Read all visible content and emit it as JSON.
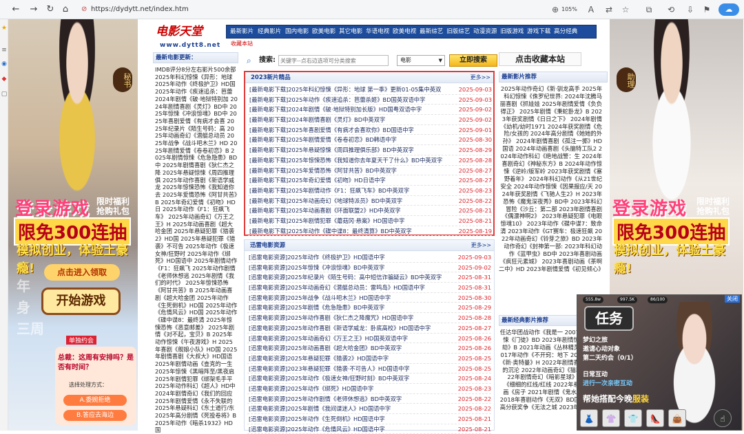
{
  "browser": {
    "url": "https://dydytt.net/index.htm",
    "zoom": "105%"
  },
  "left_ad": {
    "tag": "秘书",
    "line1": "登录游戏",
    "line1b": "限时福利抢购礼包",
    "line2": "限免300连抽",
    "line3": "模拟创业，体验土豪瘾!",
    "enter": "点击进入领取",
    "start": "开始游戏",
    "bg1": "年",
    "bg2": "身",
    "bg3": "三周",
    "chat_top": "单独约会",
    "chat_q": "总裁：这周有安排吗？是否有时间？",
    "choose": "选择处理方式：",
    "opt_a": "A.委婉拒绝",
    "opt_b": "B.答应去海边"
  },
  "right_ad": {
    "tag": "助理",
    "line1": "登录游戏",
    "line1b": "限时福利抢购礼包",
    "line2": "限免300连抽",
    "line3": "模拟创业，体验土豪瘾!"
  },
  "site": {
    "logo": "电影天堂",
    "logo_sub": "www.dytt8.net",
    "nav": [
      "最新影片",
      "经典影片",
      "国内电影",
      "欧美电影",
      "其它电影",
      "华语电视",
      "欧美电视",
      "最新综艺",
      "旧版综艺",
      "动漫资源",
      "旧版游戏",
      "游戏下载",
      "高分经典"
    ],
    "subnav": "收藏本站",
    "left_head": "最新电影更新：",
    "left_text": "IMDB评分8分左右影片500余部 2025年科幻惊悚《异形：地球 2025年动作《终极护卫》HD国 2025年动作《疾速追杀：芭蕾 2024年剧情《破·地狱特别加 2024年剧情喜剧《灵灯》BD中 2025年惊悚《冲浪惊魂》BD中 2025年喜剧爱情《有病才会喜 2025年纪录片《陌生号码：高 2025年动画奇幻《潜艇总动员 2025年战争《战斗吧木兰》HD 2025年剧情爱情《卷卷初恋》B 2025年剧情惊悚《危急隐患》BD中 2025年剧情喜剧《狄仁杰之降 2025年悬疑惊悚《周四推理俱 2025年动作喜剧《新语学威龙 2025年惊悚恐怖《我知道你去 2025年爱情恐怖《阿甘共苦》B 2025年奇幻爱情《初吻》HD日 2025年动作《F1：狂飙飞车》 2025年动画奇幻《万王之王》H 2025年动画喜剧《超大哈金团 2025年悬疑犯罪《猎袭2》HD国 2025年悬疑犯罪《猎袭》不可告 2025年动作《极速女神/狂野时 2025年动作《绑死》HD国语中 2025年剧情动作《F1：狂飙飞 2025年动作剧情《老师休想逃 2025年剧情《我们的时代》 2025年惊悚恐怖《阿甘共苦》B 2025年动画喜剧《超大哈金团 2025年动作《生死倒机》HD国 2025年动作《危情风云》HD国 2025年动作《碟中谍8：最终清 2025年惊悚恐怖《恶意邮差》 2025年剧情《对不起，宝贝》B 2025年动作惊悚《午夜游戏》H 2025年喜剧《舰娘小队》HD国 2025年剧情喜剧《大叔大》HD国语 2025年剧情动画《查克的一生 2025年惊悚《黑暗阵至/黑夜启 2025年剧情犯罪《绑架毛手平 2025年动作科幻《超人》HD中 2024年剧情奇幻《我们的回应 2025年剧情爱情《永不失联的 2025年悬疑科幻《东土道行/东 2025年高分剧情《死投卷将》B 2025年动作《暗杀1932》HD国"
  },
  "search": {
    "label": "搜索:",
    "placeholder": "关键字--点右边选项可分类搜索",
    "select": "电影",
    "button": "立即搜索"
  },
  "box_new": {
    "title": "2023新片精品",
    "more": "更多>>",
    "rows": [
      {
        "title": "[最新电影下载]2025年科幻惊悚《异形：地球 第一季》更新01-05集中英双",
        "date": "2025-09-03"
      },
      {
        "title": "[最新电影下载]2025年动作《疾速追杀：芭蕾杀姬》BD国英双语中字",
        "date": "2025-09-03"
      },
      {
        "title": "[最新电影下载]2024年剧情《破·地狱特别加长版》HD国粤双语中字",
        "date": "2025-09-02"
      },
      {
        "title": "[最新电影下载]2024年剧情喜剧《灵灯》BD中英双字",
        "date": "2025-09-02"
      },
      {
        "title": "[最新电影下载]2025年喜剧爱情《有病才会喜欢你》BD国语中字",
        "date": "2025-09-01"
      },
      {
        "title": "[最新电影下载]2025年剧情爱情《卷卷初恋》BD韩语中字",
        "date": "2025-08-30"
      },
      {
        "title": "[最新电影下载]2025年悬疑惊悚《周四推理俱乐部》BD中英双字",
        "date": "2025-08-29"
      },
      {
        "title": "[最新电影下载]2025年惊悚恐怖《我知道你去年夏天干了什么》BD中英双字",
        "date": "2025-08-28"
      },
      {
        "title": "[最新电影下载]2025年爱情恐怖《阿甘共苦》BD中英双字",
        "date": "2025-08-27"
      },
      {
        "title": "[最新电影下载]2025年奇幻爱情《初吻》HD日语中字",
        "date": "2025-08-27"
      },
      {
        "title": "[最新电影下载]2025年剧情动作《F1：狂飙飞车》BD中英双字",
        "date": "2025-08-23"
      },
      {
        "title": "[最新电影下载]2025年动画奇幻《地球特派员》BD中英双字",
        "date": "2025-08-22"
      },
      {
        "title": "[最新电影下载]2025年动画喜剧《环面联盟2》HD中英双字",
        "date": "2025-08-21"
      },
      {
        "title": "[最新电影下载]2025年剧情犯罪《蘑菇冈·悬案》HD国语中字",
        "date": "2025-08-21"
      },
      {
        "title": "[最新电影下载]2025年动作《碟中谍8：最终清算》BD中英双字",
        "date": "2025-08-19"
      }
    ]
  },
  "box_xl": {
    "title": "迅雷电影资源",
    "more": "更多>>",
    "rows": [
      {
        "title": "[迅雷电影资源]2025年动作《终极护卫》HD国语中字",
        "date": "2025-09-03"
      },
      {
        "title": "[迅雷电影资源]2025年惊悚《冲浪惊魂》BD中英双字",
        "date": "2025-09-02"
      },
      {
        "title": "[迅雷电影资源]2025年纪录片《陌生号码：高中短信诈骗疑云》BD中英双字",
        "date": "2025-08-31"
      },
      {
        "title": "[迅雷电影资源]2025年动画奇幻《潜艇总动员：雷鸣岛》HD国语中字",
        "date": "2025-08-31"
      },
      {
        "title": "[迅雷电影资源]2025年战争《战斗吧木兰》HD国语中字",
        "date": "2025-08-30"
      },
      {
        "title": "[迅雷电影资源]2025年剧情《危急隐患》BD中英双字",
        "date": "2025-08-29"
      },
      {
        "title": "[迅雷电影资源]2025年动作喜剧《狄仁杰之降魔咒》HD国语中字",
        "date": "2025-08-28"
      },
      {
        "title": "[迅雷电影资源]2025年动作喜剧《新语学威龙：卧底高校》HD国语中字",
        "date": "2025-08-27"
      },
      {
        "title": "[迅雷电影资源]2025年动画奇幻《万王之王》HD国英双语中字",
        "date": "2025-08-26"
      },
      {
        "title": "[迅雷电影资源]2025年动画喜剧《超大哈金团》BD中英双字",
        "date": "2025-08-26"
      },
      {
        "title": "[迅雷电影资源]2025年悬疑犯罪《猎袭2》HD国语中字",
        "date": "2025-08-25"
      },
      {
        "title": "[迅雷电影资源]2023年悬疑犯罪《猎袭·不可告人》HD国语中字",
        "date": "2025-08-25"
      },
      {
        "title": "[迅雷电影资源]2025年动作《极速女神/狂野时刻》BD中英双字",
        "date": "2025-08-24"
      },
      {
        "title": "[迅雷电影资源]2025年动作《绑死》HD国语中字",
        "date": "2025-08-23"
      },
      {
        "title": "[迅雷电影资源]2025年动作剧情《老师休想逃》BD中英双字",
        "date": "2025-08-22"
      },
      {
        "title": "[迅雷电影资源]2025年剧情《我间谍迷人》HD国语中字",
        "date": "2025-08-22"
      },
      {
        "title": "[迅雷电影资源]2025年动作《生死倒机》HD国语中字",
        "date": "2025-08-21"
      },
      {
        "title": "[迅雷电影资源]2025年动作《危情风云》HD国语中字",
        "date": "2025-08-21"
      }
    ]
  },
  "right_col": {
    "collect": "点击收藏本站",
    "head1": "最新影片推荐",
    "list1": "2025年动作奇幻《新·驯龙高手 2025年科幻惊悚《侏罗纪世界: 2024年沈腾马丽喜剧《抓娃娃 2025年剧情爱情《负负得正》 2025年剧情《秉蛇卧龙》B 2023年获奖剧情《日日之下》 2024年剧情《幼机/幼时1971 2024年获奖剧情《危险/女孩的 2024年高分剧情《她她的外孙》 2024年剧情喜剧《孤注一掷》HD国语 2024年动画喜剧《头脑特工队2 2024年动作科幻《绝地战警：生 2024年喜剧奇幻《神秘东方》B 2024年动作惊悚《逆岭/版军岭 2023年获奖剧情《塞野着年》 2024年科幻动作《从21世纪安全 2024年动作惊悚《因果报应/天 2024年获奖剧情《飞驰人生2》H 2023年恐怖《魔鬼深夜秀》BD中 2023年科幻冒险《沙丘：第二部 2023年剧情喜剧《偶漂神啊2》 2023年悬疑犯罪《电眼惊魂10》 2023年动作《碟中谍7：致命清 2023年动作《GT赛车：极速狂飙 2022年动画奇幻《铃芽之旅》BD 2023年动作奇幻《封神第一部: 2023年科幻动作《蓝甲虫》BD中 2023年喜剧动画《疯狂元素城》 2023年喜剧动画《茶啊二中》HD 2023年剧情爱情《初见倾心》",
    "head2": "最新经典影片推荐",
    "list2": "任达华团战动作《我是一 2007年剧情惊悚《门徒》BD 2023年剧情惊悚《瞒天劫》B 2021年动画《丛林精灵：森林 2017年动作《不开窍：地下 2022年科幻《新·奥特曼》H 2022年剧情喜剧《刹那的沉沦 2022年动画奇幻《猫和老鼠 2022年剧情奇幻《暗影星球》 高分获奖《细细的红线/红线 2022年悬疑剧情动画《房子 2021年剧情《鬼水漂流》BD 2018年喜剧动作《无双》BD国 2015年高分获奖争《无法之城 2023年动作奇幻《十二宫》"
  },
  "float_ad": {
    "stat1": "555.8w",
    "stat2": "997.5K",
    "stat3": "86/100",
    "close": "关闭",
    "task": "任务",
    "t1": "梦幻之旅",
    "t2": "邀请心动对象",
    "t3": "第二天约会（0/1）",
    "t4": "日常互动",
    "t5": "进行一次亲密互动",
    "help": "帮她搭配今晚",
    "help_em": "服装"
  }
}
